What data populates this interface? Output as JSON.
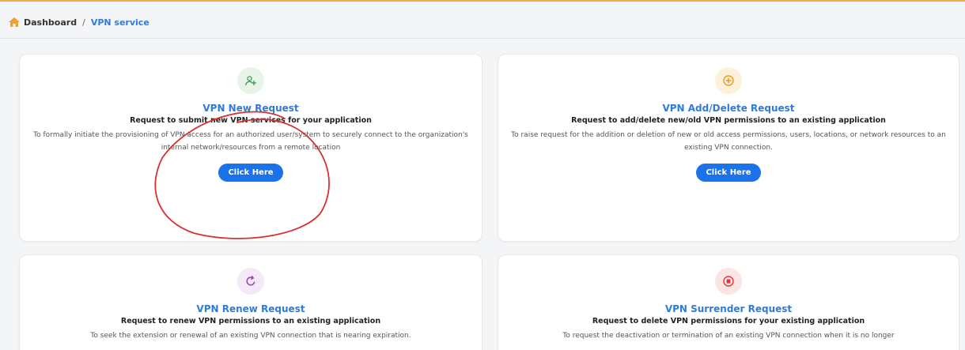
{
  "breadcrumb": {
    "home": "Dashboard",
    "separator": "/",
    "current": "VPN service"
  },
  "colors": {
    "accent": "#1a73e8",
    "title": "#2f7bd6",
    "top_border": "#f0a94a",
    "annotation": "#d93030"
  },
  "cards": [
    {
      "icon": "user-add-icon",
      "title": "VPN New Request",
      "subtitle": "Request to submit new VPN services for your application",
      "description": "To formally initiate the provisioning of VPN access for an authorized user/system to securely connect to the organization's internal network/resources from a remote location",
      "button": "Click Here"
    },
    {
      "icon": "plus-circle-icon",
      "title": "VPN Add/Delete Request",
      "subtitle": "Request to add/delete new/old VPN permissions to an existing application",
      "description": "To raise request for the addition or deletion of new or old access permissions, users, locations, or network resources to an existing VPN connection.",
      "button": "Click Here"
    },
    {
      "icon": "refresh-icon",
      "title": "VPN Renew Request",
      "subtitle": "Request to renew VPN permissions to an existing application",
      "description": "To seek the extension or renewal of an existing VPN connection that is nearing expiration."
    },
    {
      "icon": "stop-circle-icon",
      "title": "VPN Surrender Request",
      "subtitle": "Request to delete VPN permissions for your existing application",
      "description": "To request the deactivation or termination of an existing VPN connection when it is no longer"
    }
  ]
}
